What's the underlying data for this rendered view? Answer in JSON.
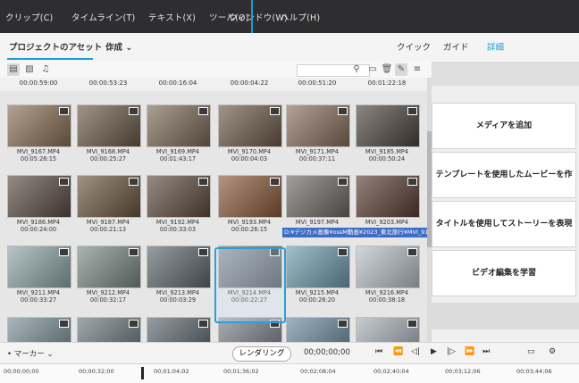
{
  "menu": [
    "クリップ(C)",
    "タイムライン(T)",
    "テキスト(X)",
    "ツール(O)",
    "ウィンドウ(W)",
    "ヘルプ(H)"
  ],
  "tabs": {
    "assets": "プロジェクトのアセット",
    "create": "作成",
    "quick": "クイック",
    "guide": "ガイド",
    "expert": "詳細"
  },
  "top_durations": [
    "00:00:59:00",
    "00:00:53:23",
    "00:00:16:04",
    "00:00:04:22",
    "00:00:51:20",
    "00:01:22:18"
  ],
  "rows": [
    [
      {
        "name": "MVI_9167.MP4",
        "dur": "00:05:26:15",
        "color": "#8a7055"
      },
      {
        "name": "MVI_9168.MP4",
        "dur": "00:00:25:27",
        "color": "#6a5a46"
      },
      {
        "name": "MVI_9169.MP4",
        "dur": "00:01:43:17",
        "color": "#7d6a58"
      },
      {
        "name": "MVI_9170.MP4",
        "dur": "00:00:04:03",
        "color": "#6e5a48"
      },
      {
        "name": "MVI_9171.MP4",
        "dur": "00:00:37:11",
        "color": "#8a6e5e"
      },
      {
        "name": "MVI_9185.MP4",
        "dur": "00:00:50:24",
        "color": "#4e4540"
      }
    ],
    [
      {
        "name": "MVI_9186.MP4",
        "dur": "00:00:24:00",
        "color": "#5a4d42"
      },
      {
        "name": "MVI_9187.MP4",
        "dur": "00:00:21:13",
        "color": "#6b5640"
      },
      {
        "name": "MVI_9192.MP4",
        "dur": "00:00:33:03",
        "color": "#604c3d"
      },
      {
        "name": "MVI_9193.MP4",
        "dur": "00:00:26:15",
        "color": "#8c5a3c"
      },
      {
        "name": "MVI_9197.MP4",
        "dur": "",
        "color": "#6e6a66"
      },
      {
        "name": "MVI_9203.MP4",
        "dur": "",
        "color": "#5a3e34"
      }
    ],
    [
      {
        "name": "MVI_9211.MP4",
        "dur": "00:00:33:27",
        "color": "#8fa6a8"
      },
      {
        "name": "MVI_9212.MP4",
        "dur": "00:00:32:17",
        "color": "#7b8a86"
      },
      {
        "name": "MVI_9213.MP4",
        "dur": "00:00:03:29",
        "color": "#5f6a70"
      },
      {
        "name": "MVI_9214.MP4",
        "dur": "00:00:22:27",
        "color": "#6a7078"
      },
      {
        "name": "MVI_9215.MP4",
        "dur": "00:00:26:20",
        "color": "#6f9bb0"
      },
      {
        "name": "MVI_9216.MP4",
        "dur": "00:00:38:18",
        "color": "#b9c2c8"
      }
    ],
    [
      {
        "name": "",
        "dur": "",
        "color": "#7a8e96"
      },
      {
        "name": "",
        "dur": "",
        "color": "#6a7a80"
      },
      {
        "name": "",
        "dur": "",
        "color": "#5c6870"
      },
      {
        "name": "",
        "dur": "",
        "color": "#7b8088"
      },
      {
        "name": "",
        "dur": "",
        "color": "#6a8c9e"
      },
      {
        "name": "",
        "dur": "",
        "color": "#a8b0b8"
      }
    ]
  ],
  "tooltip": "D:¥デジカメ画像¥ossM動画¥2023_東北旅行¥MVI_9193.MP4",
  "right_panel": {
    "add_media": "メディアを追加",
    "template": "テンプレートを使用したムービーを作成",
    "titles": "タイトルを使用してストーリーを表現",
    "learn": "ビデオ編集を学習"
  },
  "bottom": {
    "marker": "マーカー",
    "render": "レンダリング",
    "timecode": "00;00;00;00"
  },
  "ruler": [
    "00;00;00;00",
    "00;00;32;00",
    "00;01;04;02",
    "00;01;36;02",
    "00;02;08;04",
    "00;02;40;04",
    "00;03;12;06",
    "00;03;44;06"
  ]
}
